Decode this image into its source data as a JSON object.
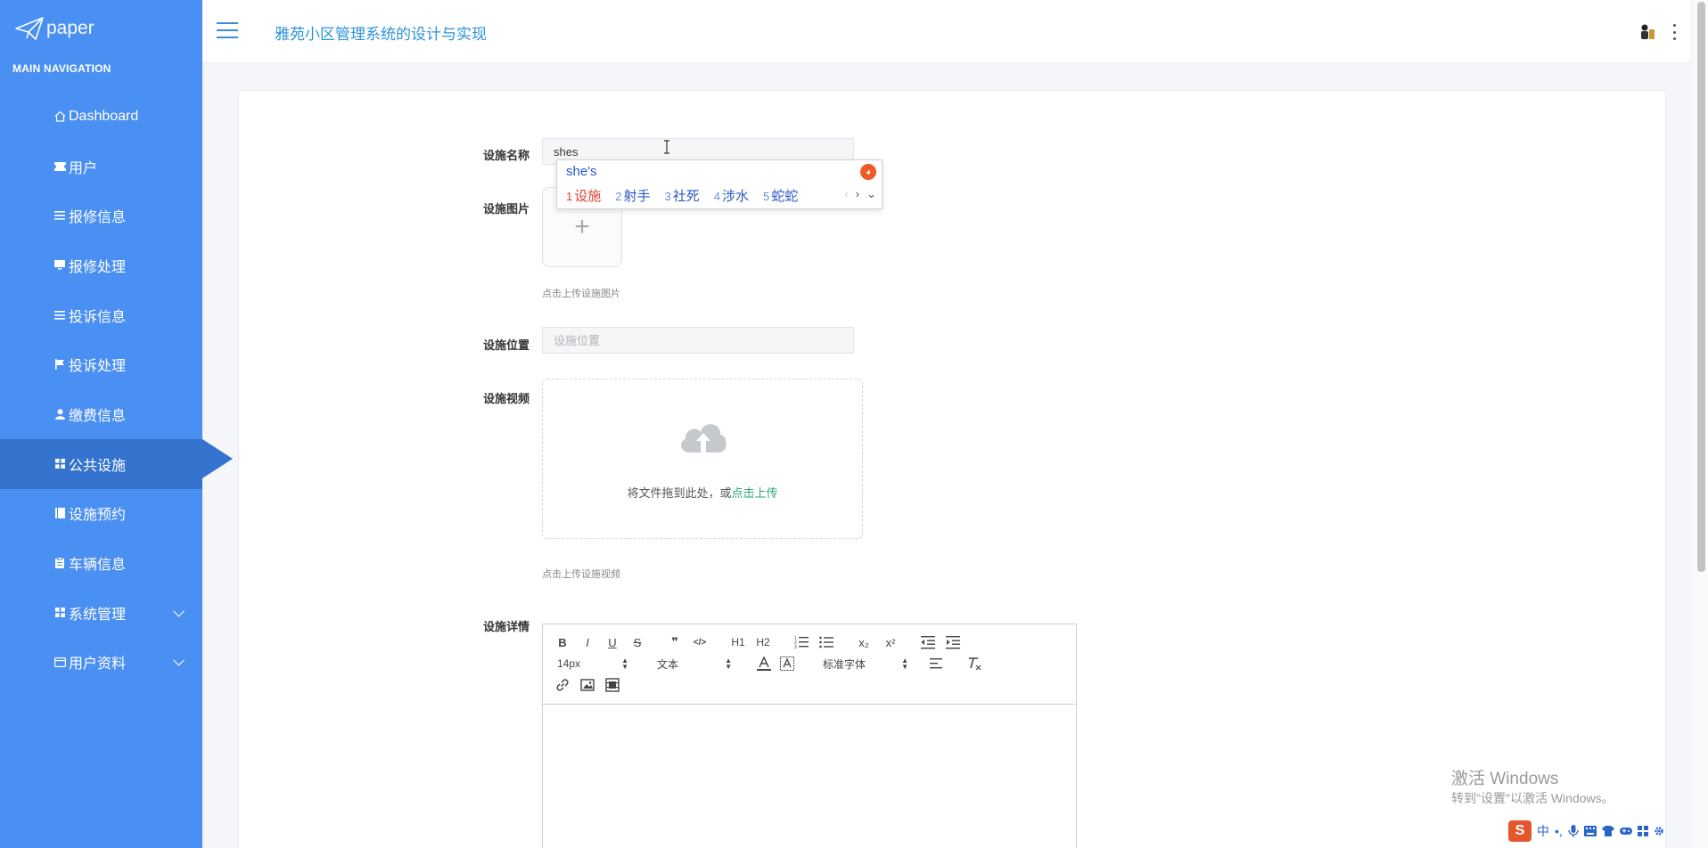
{
  "brand": {
    "logo_text": "paper"
  },
  "sidebar": {
    "header": "MAIN NAVIGATION",
    "items": [
      {
        "label": "Dashboard",
        "icon": "home-icon"
      },
      {
        "label": "用户",
        "icon": "ticket-icon"
      },
      {
        "label": "报修信息",
        "icon": "list-icon"
      },
      {
        "label": "报修处理",
        "icon": "monitor-icon"
      },
      {
        "label": "投诉信息",
        "icon": "list-icon"
      },
      {
        "label": "投诉处理",
        "icon": "flag-icon"
      },
      {
        "label": "缴费信息",
        "icon": "user-icon"
      },
      {
        "label": "公共设施",
        "icon": "grid-icon",
        "active": true
      },
      {
        "label": "设施预约",
        "icon": "book-icon"
      },
      {
        "label": "车辆信息",
        "icon": "clipboard-icon"
      },
      {
        "label": "系统管理",
        "icon": "grid-icon",
        "expandable": true
      },
      {
        "label": "用户资料",
        "icon": "card-icon",
        "expandable": true
      }
    ],
    "colors": {
      "bg": "#4a8ff2",
      "active": "#3474cf"
    }
  },
  "header": {
    "title": "雅苑小区管理系统的设计与实现"
  },
  "form": {
    "name_label": "设施名称",
    "name_value": "shes",
    "image_label": "设施图片",
    "image_tip": "点击上传设施图片",
    "location_label": "设施位置",
    "location_placeholder": "设施位置",
    "video_label": "设施视频",
    "drop_text": "将文件拖到此处，或",
    "drop_link": "点击上传",
    "video_tip": "点击上传设施视频",
    "detail_label": "设施详情"
  },
  "editor": {
    "size_value": "14px",
    "header_value": "文本",
    "font_value": "标准字体",
    "buttons": {
      "bold": "B",
      "italic": "I",
      "underline": "U",
      "strike": "S",
      "quote": "❞",
      "code": "</>",
      "h1": "H1",
      "h2": "H2",
      "subscript": "x₂",
      "superscript": "x²"
    }
  },
  "ime": {
    "composing": "she's",
    "candidates": [
      {
        "n": "1",
        "text": "设施"
      },
      {
        "n": "2",
        "text": "射手"
      },
      {
        "n": "3",
        "text": "社死"
      },
      {
        "n": "4",
        "text": "涉水"
      },
      {
        "n": "5",
        "text": "蛇蛇"
      }
    ]
  },
  "watermark": {
    "line1": "激活 Windows",
    "line2": "转到\"设置\"以激活 Windows。"
  },
  "tray": {
    "logo": "S",
    "lang": "中",
    "punct": "•,"
  }
}
